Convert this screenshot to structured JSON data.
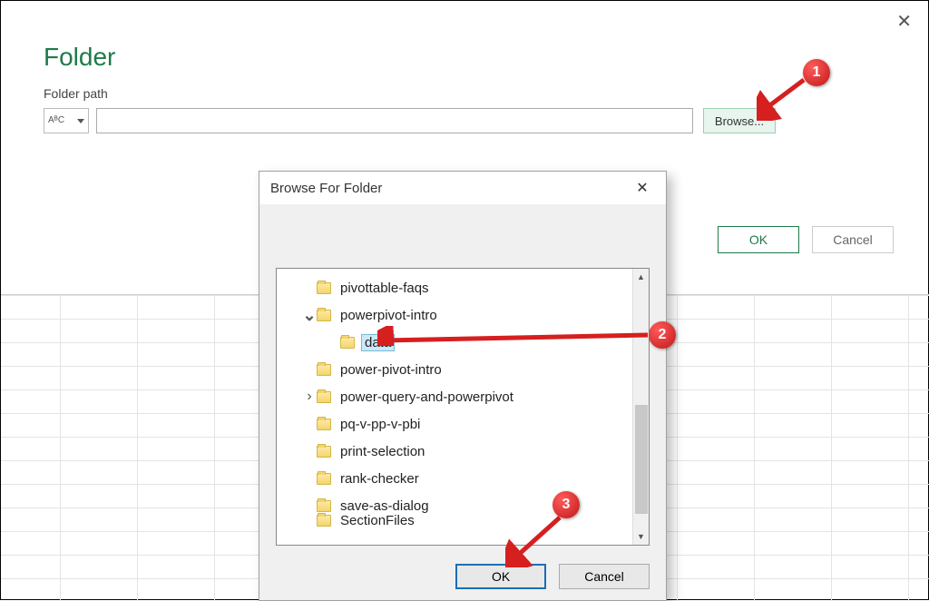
{
  "dialog": {
    "title": "Folder",
    "path_label": "Folder path",
    "type_hint": "AᴮC",
    "path_value": "",
    "browse_label": "Browse...",
    "ok_label": "OK",
    "cancel_label": "Cancel"
  },
  "browse": {
    "title": "Browse For Folder",
    "ok_label": "OK",
    "cancel_label": "Cancel",
    "items": [
      {
        "label": "pivottable-faqs",
        "indent": 1,
        "expander": "",
        "selected": false
      },
      {
        "label": "powerpivot-intro",
        "indent": 1,
        "expander": "v",
        "selected": false
      },
      {
        "label": "data",
        "indent": 2,
        "expander": "",
        "selected": true
      },
      {
        "label": "power-pivot-intro",
        "indent": 1,
        "expander": "",
        "selected": false
      },
      {
        "label": "power-query-and-powerpivot",
        "indent": 1,
        "expander": ">",
        "selected": false
      },
      {
        "label": "pq-v-pp-v-pbi",
        "indent": 1,
        "expander": "",
        "selected": false
      },
      {
        "label": "print-selection",
        "indent": 1,
        "expander": "",
        "selected": false
      },
      {
        "label": "rank-checker",
        "indent": 1,
        "expander": "",
        "selected": false
      },
      {
        "label": "save-as-dialog",
        "indent": 1,
        "expander": "",
        "selected": false
      },
      {
        "label": "SectionFiles",
        "indent": 1,
        "expander": "",
        "selected": false,
        "cutoff": true
      }
    ]
  },
  "annotations": {
    "c1": "1",
    "c2": "2",
    "c3": "3"
  }
}
